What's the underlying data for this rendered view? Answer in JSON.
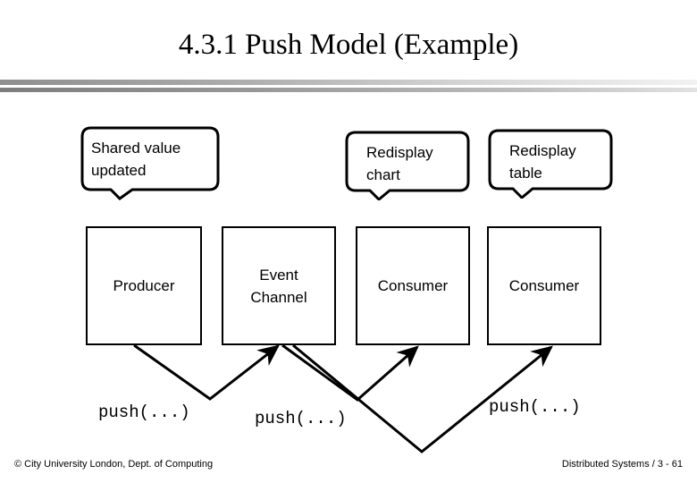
{
  "slide": {
    "title": "4.3.1 Push Model (Example)"
  },
  "callouts": [
    {
      "name": "shared-value-updated",
      "line1": "Shared value",
      "line2": "updated"
    },
    {
      "name": "redisplay-chart",
      "line1": "Redisplay",
      "line2": "chart"
    },
    {
      "name": "redisplay-table",
      "line1": "Redisplay",
      "line2": "table"
    }
  ],
  "nodes": [
    {
      "name": "producer",
      "line1": "Producer",
      "line2": ""
    },
    {
      "name": "event-channel",
      "line1": "Event",
      "line2": "Channel"
    },
    {
      "name": "consumer-1",
      "line1": "Consumer",
      "line2": ""
    },
    {
      "name": "consumer-2",
      "line1": "Consumer",
      "line2": ""
    }
  ],
  "code_labels": [
    {
      "name": "push-call-producer",
      "text": "push(...)"
    },
    {
      "name": "push-call-channel-1",
      "text": "push(...)"
    },
    {
      "name": "push-call-channel-2",
      "text": "push(...)"
    }
  ],
  "footer": {
    "copyright": "© City University London, Dept. of Computing",
    "course": "Distributed Systems / 3 - 61"
  },
  "colors": {
    "ink": "#000000",
    "page": "#ffffff",
    "rule_light": "#a8a8a8",
    "rule_dark": "#7d7d7d"
  }
}
